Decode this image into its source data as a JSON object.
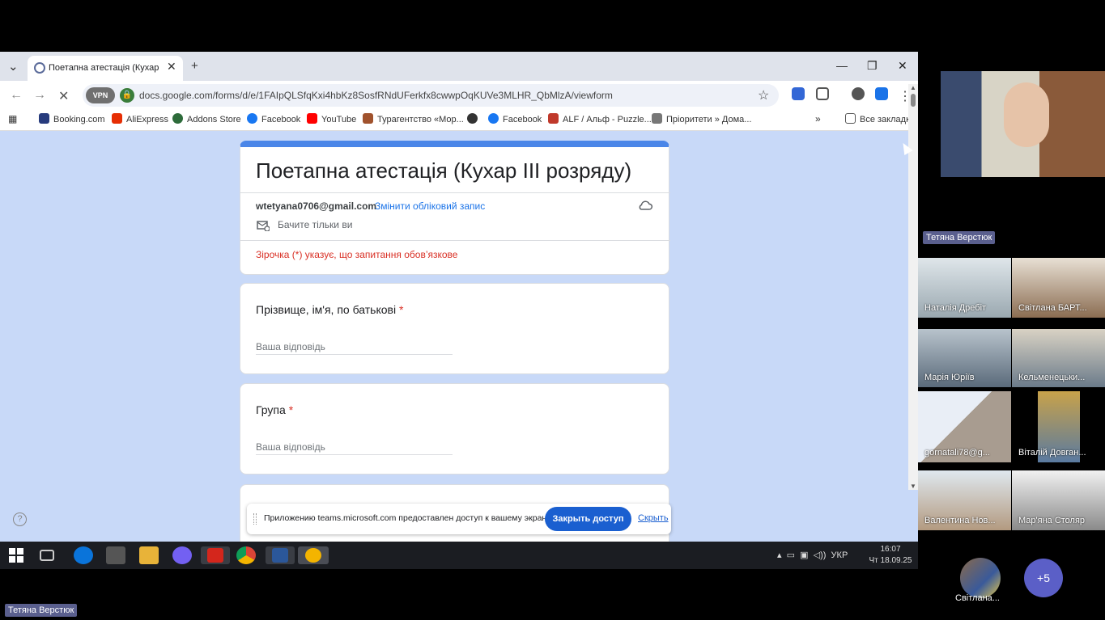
{
  "browser": {
    "tab_title": "Поетапна атестація (Кухар ІІІ р",
    "url": "docs.google.com/forms/d/e/1FAIpQLSfqKxi4hbKz8SosfRNdUFerkfx8cwwpOqKUVe3MLHR_QbMlzA/viewform",
    "vpn_label": "VPN",
    "bookmarks": [
      "Booking.com",
      "AliExpress",
      "Addons Store",
      "Facebook",
      "YouTube",
      "Турагентство «Мор...",
      "Facebook",
      "ALF / Альф - Puzzle...",
      "Пріоритети » Дома..."
    ],
    "all_bookmarks": "Все закладки"
  },
  "form": {
    "title": "Поетапна атестація (Кухар ІІІ розряду)",
    "email": "wtetyana0706@gmail.com",
    "switch_account": "Змінити обліковий запис",
    "only_you": "Бачите тільки ви",
    "required_note": "Зірочка (*) указує, що запитання обов’язкове",
    "questions": [
      {
        "label": "Прізвище, ім'я, по батькові",
        "placeholder": "Ваша відповідь"
      },
      {
        "label": "Група",
        "placeholder": "Ваша відповідь"
      }
    ],
    "required_marker": "*"
  },
  "share_bar": {
    "text": "Приложению teams.microsoft.com предоставлен доступ к вашему экрану.",
    "stop_button": "Закрыть доступ",
    "hide_link": "Скрыть"
  },
  "taskbar": {
    "lang": "УКР",
    "time": "16:07",
    "date": "Чт 18.09.25"
  },
  "teams": {
    "main_speaker": "Тетяна Верстюк",
    "participants": [
      "Наталія Дребіт",
      "Світлана БАРТ...",
      "Марія Юріїв",
      "Кельменецьки...",
      "gornatali78@g...",
      "Віталій Довган...",
      "Валентина Нов...",
      "Мар'яна Столяр"
    ],
    "last_avatar_name": "Світлана...",
    "more_count": "+5",
    "presenter_label": "Тетяна Верстюк"
  }
}
